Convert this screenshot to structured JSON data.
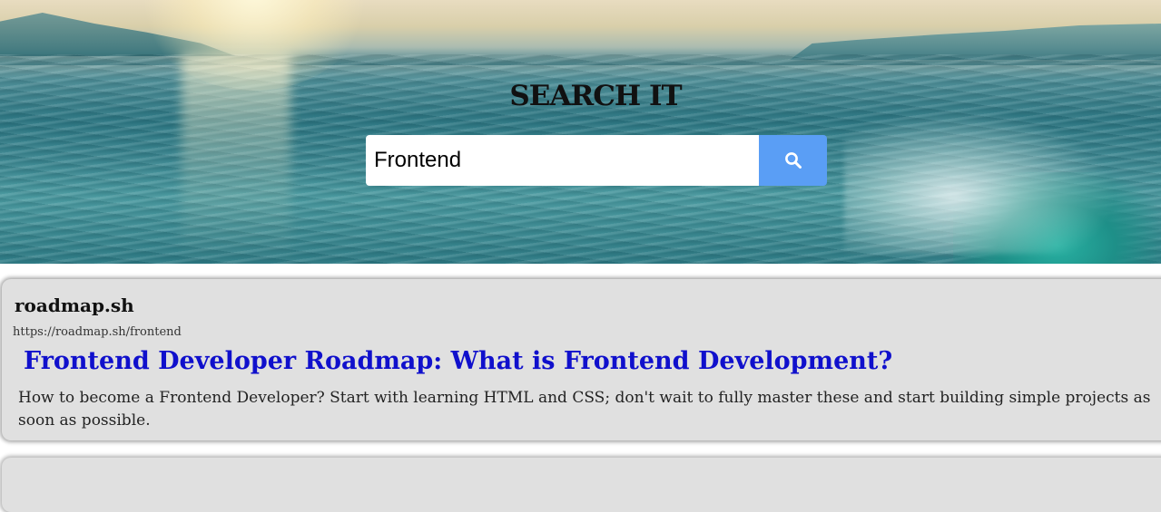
{
  "header": {
    "title": "SEARCH IT"
  },
  "search": {
    "value": "Frontend",
    "button_icon": "search-icon",
    "button_color": "#5a9ef5"
  },
  "results": [
    {
      "site": "roadmap.sh",
      "url": "https://roadmap.sh/frontend",
      "title": "Frontend Developer Roadmap: What is Frontend Development?",
      "description": "How to become a Frontend Developer? Start with learning HTML and CSS; don't wait to fully master these and start building simple projects as soon as possible."
    }
  ],
  "colors": {
    "result_title": "#1010cc",
    "card_background": "#e0e0e0"
  }
}
